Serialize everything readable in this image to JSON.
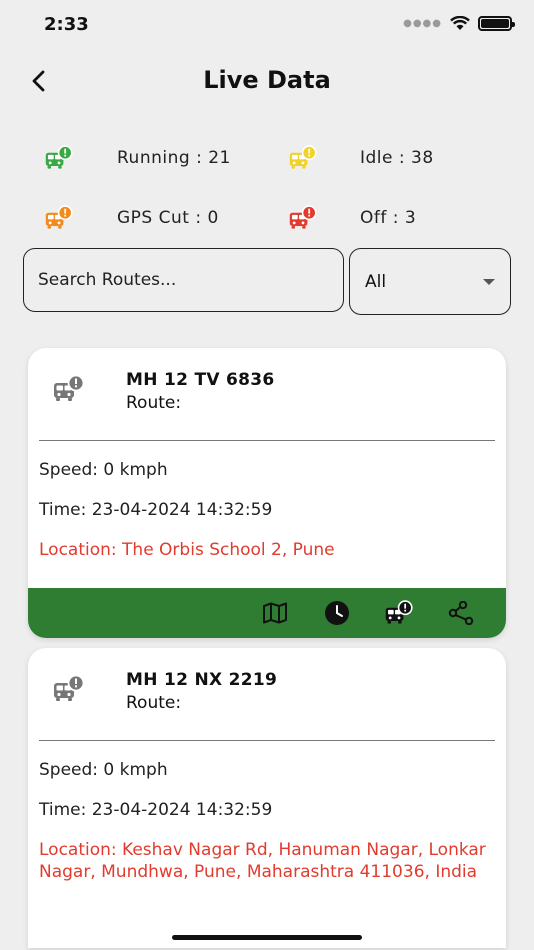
{
  "status_bar": {
    "time": "2:33"
  },
  "header": {
    "title": "Live Data"
  },
  "stats": {
    "running": {
      "label": "Running : 21",
      "color": "#3aa845"
    },
    "idle": {
      "label": "Idle : 38",
      "color": "#f2d12a"
    },
    "gps_cut": {
      "label": "GPS Cut : 0",
      "color": "#f28a1e"
    },
    "off": {
      "label": "Off : 3",
      "color": "#e23b2e"
    }
  },
  "search": {
    "placeholder": "Search Routes..."
  },
  "filter": {
    "selected": "All"
  },
  "vehicles": [
    {
      "number": "MH 12 TV 6836",
      "route": "Route:",
      "speed": "Speed: 0 kmph",
      "time": "Time: 23-04-2024 14:32:59",
      "location": "Location: The Orbis School 2, Pune",
      "actions": [
        "map-icon",
        "clock-icon",
        "bus-alert-icon",
        "share-icon"
      ]
    },
    {
      "number": "MH 12 NX 2219",
      "route": "Route:",
      "speed": "Speed: 0 kmph",
      "time": "Time: 23-04-2024 14:32:59",
      "location": "Location: Keshav Nagar Rd, Hanuman Nagar, Lonkar Nagar, Mundhwa, Pune, Maharashtra 411036, India"
    }
  ],
  "colors": {
    "accent_green": "#2e7d32",
    "location_red": "#e23b2e",
    "card_icon_grey": "#777777"
  }
}
